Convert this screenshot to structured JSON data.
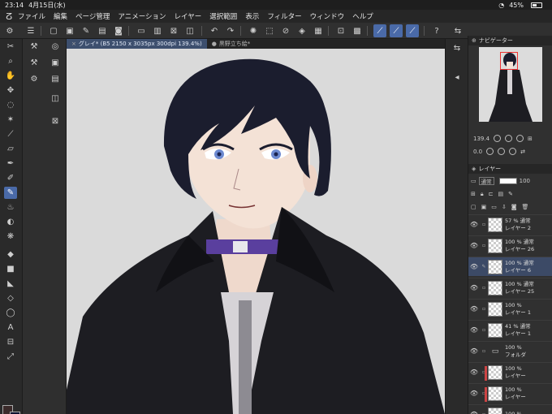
{
  "status": {
    "time": "23:14",
    "date": "4月15日(水)",
    "battery": "45%",
    "battery_level": 0.45
  },
  "menu": [
    "ファイル",
    "編集",
    "ページ管理",
    "アニメーション",
    "レイヤー",
    "選択範囲",
    "表示",
    "フィルター",
    "ウィンドウ",
    "ヘルプ"
  ],
  "tabs": [
    {
      "label": "グレイ* (B5 2150 x 3035px 300dpi 139.4%)",
      "active": true
    },
    {
      "label": "黒野立ち絵*",
      "active": false
    }
  ],
  "navigator": {
    "title": "ナビゲーター",
    "zoom": "139.4",
    "angle": "0.0"
  },
  "layers": {
    "title": "レイヤー",
    "blend_mode": "通常",
    "opacity": "100",
    "items": [
      {
        "top": "57 % 通常",
        "bottom": "レイヤー 2",
        "selected": false,
        "marker": false
      },
      {
        "top": "100 % 通常",
        "bottom": "レイヤー 26",
        "selected": false,
        "marker": false
      },
      {
        "top": "100 % 通常",
        "bottom": "レイヤー 6",
        "selected": true,
        "marker": false
      },
      {
        "top": "100 % 通常",
        "bottom": "レイヤー 25",
        "selected": false,
        "marker": false
      },
      {
        "top": "100 %",
        "bottom": "レイヤー 1",
        "selected": false,
        "marker": false
      },
      {
        "top": "41 % 通常",
        "bottom": "レイヤー 1",
        "selected": false,
        "marker": false
      },
      {
        "top": "100 %",
        "bottom": "フォルダ",
        "selected": false,
        "marker": false,
        "folder": true
      },
      {
        "top": "100 %",
        "bottom": "レイヤー",
        "selected": false,
        "marker": true
      },
      {
        "top": "100 %",
        "bottom": "レイヤー",
        "selected": false,
        "marker": true
      },
      {
        "top": "100 %",
        "bottom": "",
        "selected": false,
        "marker": false
      }
    ]
  },
  "colors": {
    "main": "#3b2a2a",
    "sub": "#0d1230",
    "accent": "#4a6aa8"
  }
}
